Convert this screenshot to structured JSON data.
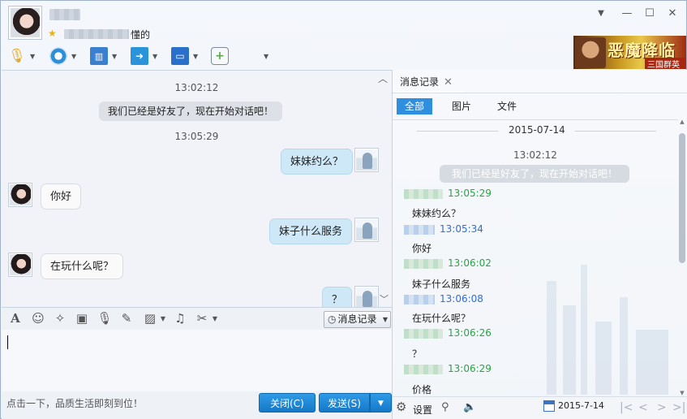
{
  "title_bar": {
    "signature_suffix": "懂的",
    "controls": {
      "dropdown": "▼",
      "minimize": "—",
      "maximize": "☐",
      "close": "✕"
    }
  },
  "toolbar": {
    "items": [
      {
        "name": "voice-call",
        "icon": "microphone-icon",
        "color": "#e8a71e"
      },
      {
        "name": "video-call",
        "icon": "webcam-icon",
        "color": "#2d8fd8"
      },
      {
        "name": "screen-share",
        "icon": "presentation-icon",
        "color": "#3a7fd0"
      },
      {
        "name": "send-file",
        "icon": "folder-icon",
        "color": "#2a93d9"
      },
      {
        "name": "remote-desktop",
        "icon": "monitor-icon",
        "color": "#2a6fc9"
      },
      {
        "name": "new-discussion",
        "icon": "chat-add-icon",
        "color": "#5aa84a"
      },
      {
        "name": "apps",
        "icon": "apps-grid-icon",
        "color": "#e2532d"
      }
    ]
  },
  "banner": {
    "title": "恶魔降临",
    "subtitle": "三国群英战"
  },
  "chat": {
    "timestamps": [
      "13:02:12",
      "13:05:29"
    ],
    "system_message": "我们已经是好友了，现在开始对话吧！",
    "messages": [
      {
        "side": "me",
        "text": "妹妹约么？"
      },
      {
        "side": "other",
        "text": "你好"
      },
      {
        "side": "me",
        "text": "妹子什么服务"
      },
      {
        "side": "other",
        "text": "在玩什么呢？"
      },
      {
        "side": "me",
        "text": "？"
      }
    ]
  },
  "input_toolbar": {
    "history_button": "消息记录"
  },
  "bottom": {
    "ad_text": "点击一下，品质生活即刻到位！",
    "close_button": "关闭(C)",
    "send_button": "发送(S)"
  },
  "history": {
    "tab_label": "消息记录",
    "filters": [
      "全部",
      "图片",
      "文件"
    ],
    "date_header": "2015-07-14",
    "first_time": "13:02:12",
    "system_message": "我们已经是好友了，现在开始对话吧！",
    "entries": [
      {
        "sender": "other",
        "time": "13:05:29",
        "text": "妹妹约么？"
      },
      {
        "sender": "me",
        "time": "13:05:34",
        "text": "你好"
      },
      {
        "sender": "other",
        "time": "13:06:02",
        "text": "妹子什么服务"
      },
      {
        "sender": "me",
        "time": "13:06:08",
        "text": "在玩什么呢？"
      },
      {
        "sender": "other",
        "time": "13:06:26",
        "text": "？"
      },
      {
        "sender": "other",
        "time": "13:06:29",
        "text": "价格"
      }
    ],
    "settings_label": "设置",
    "date_field": "2015-7-14"
  }
}
